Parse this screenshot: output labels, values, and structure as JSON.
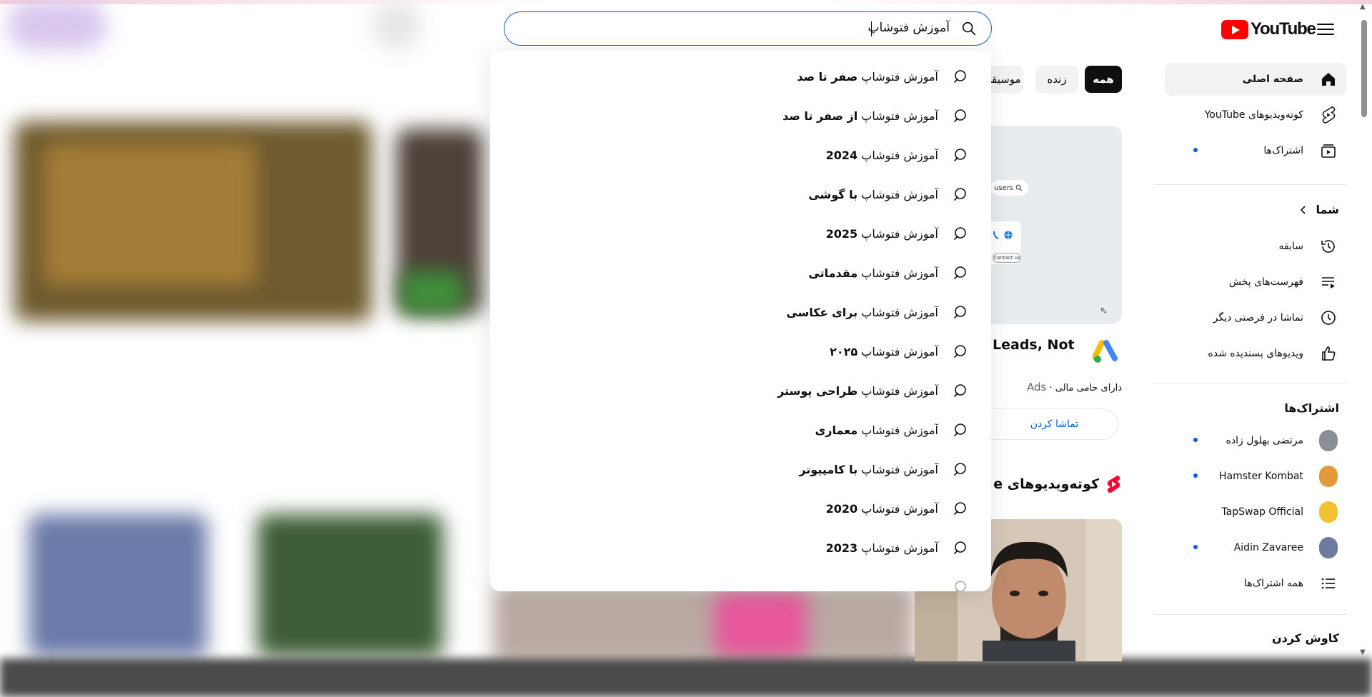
{
  "header": {
    "logo_text": "YouTube",
    "search_value": "آموزش فتوشاپ"
  },
  "suggestions": [
    {
      "prefix": "آموزش فتوشاپ",
      "suffix": "صفر تا صد"
    },
    {
      "prefix": "آموزش فتوشاپ",
      "suffix": "از صفر تا صد"
    },
    {
      "prefix": "آموزش فتوشاپ",
      "suffix": "2024"
    },
    {
      "prefix": "آموزش فتوشاپ",
      "suffix": "با گوشی"
    },
    {
      "prefix": "آموزش فتوشاپ",
      "suffix": "2025"
    },
    {
      "prefix": "آموزش فتوشاپ",
      "suffix": "مقدماتی"
    },
    {
      "prefix": "آموزش فتوشاپ",
      "suffix": "برای عکاسی"
    },
    {
      "prefix": "آموزش فتوشاپ",
      "suffix": "۲۰۲۵"
    },
    {
      "prefix": "آموزش فتوشاپ",
      "suffix": "طراحی پوستر"
    },
    {
      "prefix": "آموزش فتوشاپ",
      "suffix": "معماری"
    },
    {
      "prefix": "آموزش فتوشاپ",
      "suffix": "با کامپیوتر"
    },
    {
      "prefix": "آموزش فتوشاپ",
      "suffix": "2020"
    },
    {
      "prefix": "آموزش فتوشاپ",
      "suffix": "2023"
    }
  ],
  "chips": {
    "all": "همه",
    "live": "زنده",
    "music": "موسیقی"
  },
  "ad": {
    "pill_text": "users",
    "mini_button": "Contact us",
    "title": "Leads, Not",
    "sponsored": "دارای حامی مالی ·",
    "ads_label": "Ads",
    "watch_button": "تماشا کردن"
  },
  "shorts": {
    "title": "کوته‌ویدیوهای e"
  },
  "sidebar": {
    "main": [
      {
        "label": "صفحه اصلی"
      },
      {
        "label": "کوته‌ویدیوهای YouTube"
      },
      {
        "label": "اشتراک‌ها"
      }
    ],
    "you_title": "شما",
    "you": [
      {
        "label": "سابقه"
      },
      {
        "label": "فهرست‌های پخش"
      },
      {
        "label": "تماشا در فرصتی دیگر"
      },
      {
        "label": "ویدیوهای پسندیده شده"
      }
    ],
    "subs_title": "اشتراک‌ها",
    "subs": [
      {
        "label": "مرتضی بهلول زاده",
        "color": "#8a8f96"
      },
      {
        "label": "Hamster Kombat",
        "color": "#e39a3b"
      },
      {
        "label": "TapSwap Official",
        "color": "#f2c232"
      },
      {
        "label": "Aidin Zavaree",
        "color": "#6d7aa0"
      }
    ],
    "all_subs": "همه اشتراک‌ها",
    "explore_title": "کاوش کردن"
  },
  "colors": {
    "accent": "#065fd4",
    "brand": "#ff0000",
    "search_border": "#1c62b9"
  }
}
